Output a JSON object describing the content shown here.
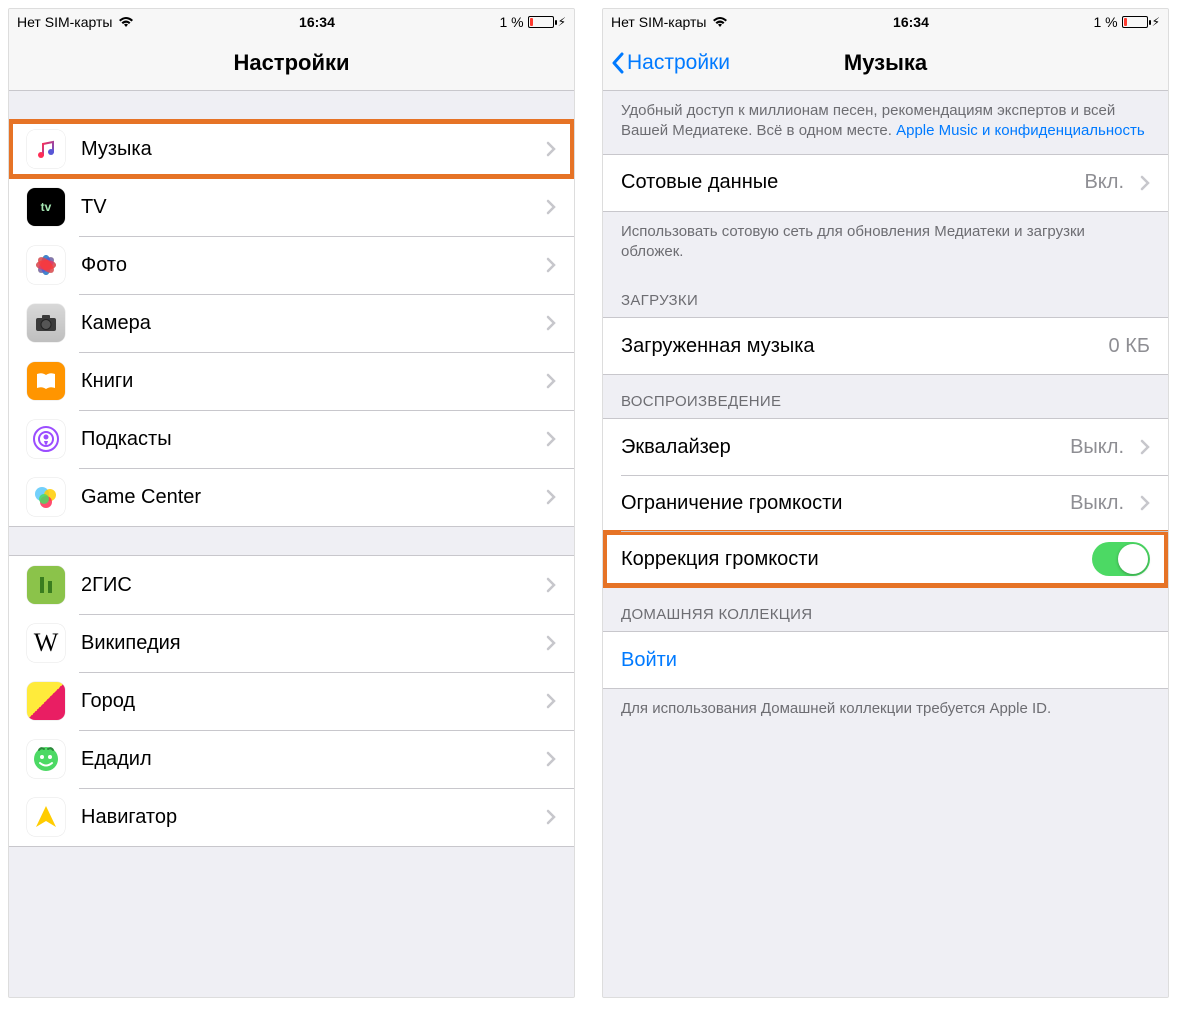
{
  "status": {
    "carrier": "Нет SIM-карты",
    "time": "16:34",
    "battery_pct": "1 %"
  },
  "left": {
    "title": "Настройки",
    "items_a": [
      {
        "id": "music",
        "label": "Музыка",
        "highlighted": true
      },
      {
        "id": "tv",
        "label": "TV"
      },
      {
        "id": "photos",
        "label": "Фото"
      },
      {
        "id": "camera",
        "label": "Камера"
      },
      {
        "id": "books",
        "label": "Книги"
      },
      {
        "id": "podcasts",
        "label": "Подкасты"
      },
      {
        "id": "gamecenter",
        "label": "Game Center"
      }
    ],
    "items_b": [
      {
        "id": "dgis",
        "label": "2ГИС"
      },
      {
        "id": "wiki",
        "label": "Википедия"
      },
      {
        "id": "gorod",
        "label": "Город"
      },
      {
        "id": "edadil",
        "label": "Едадил"
      },
      {
        "id": "navigator",
        "label": "Навигатор"
      }
    ]
  },
  "right": {
    "back": "Настройки",
    "title": "Музыка",
    "intro_text": "Удобный доступ к миллионам песен, рекомендациям экспертов и всей Вашей Медиатеке. Всё в одном месте. ",
    "intro_link": "Apple Music и конфиденциальность",
    "cellular": {
      "label": "Сотовые данные",
      "value": "Вкл."
    },
    "cellular_footer": "Использовать сотовую сеть для обновления Медиатеки и загрузки обложек.",
    "downloads_header": "ЗАГРУЗКИ",
    "downloaded": {
      "label": "Загруженная музыка",
      "value": "0 КБ"
    },
    "playback_header": "ВОСПРОИЗВЕДЕНИЕ",
    "eq": {
      "label": "Эквалайзер",
      "value": "Выкл."
    },
    "volume_limit": {
      "label": "Ограничение громкости",
      "value": "Выкл."
    },
    "sound_check": {
      "label": "Коррекция громкости",
      "highlighted": true
    },
    "home_header": "ДОМАШНЯЯ КОЛЛЕКЦИЯ",
    "signin": "Войти",
    "home_footer": "Для использования Домашней коллекции требуется Apple ID."
  }
}
